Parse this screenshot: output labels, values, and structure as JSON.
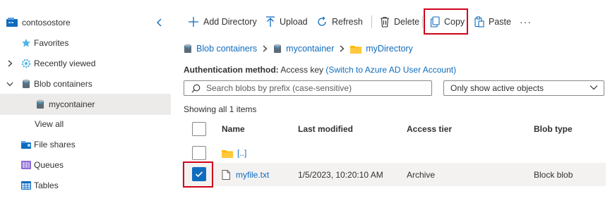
{
  "sidebar": {
    "account": "contosostore",
    "items": [
      {
        "label": "Favorites"
      },
      {
        "label": "Recently viewed"
      },
      {
        "label": "Blob containers"
      },
      {
        "label": "mycontainer"
      },
      {
        "label": "View all"
      },
      {
        "label": "File shares"
      },
      {
        "label": "Queues"
      },
      {
        "label": "Tables"
      }
    ]
  },
  "toolbar": {
    "add_directory": "Add Directory",
    "upload": "Upload",
    "refresh": "Refresh",
    "delete": "Delete",
    "copy": "Copy",
    "paste": "Paste",
    "more": "···"
  },
  "breadcrumb": [
    "Blob containers",
    "mycontainer",
    "myDirectory"
  ],
  "auth": {
    "label": "Authentication method:",
    "value": "Access key",
    "switch_link": "(Switch to Azure AD User Account)"
  },
  "search": {
    "placeholder": "Search blobs by prefix (case-sensitive)"
  },
  "filter": {
    "selected": "Only show active objects"
  },
  "showing": "Showing all 1 items",
  "table": {
    "columns": [
      "Name",
      "Last modified",
      "Access tier",
      "Blob type"
    ],
    "parent_row": {
      "name": "[..]"
    },
    "rows": [
      {
        "name": "myfile.txt",
        "last_modified": "1/5/2023, 10:20:10 AM",
        "access_tier": "Archive",
        "blob_type": "Block blob",
        "selected": true
      }
    ]
  },
  "colors": {
    "accent": "#0f6cbd",
    "highlight": "#d0021b",
    "folder": "#ffb900"
  }
}
